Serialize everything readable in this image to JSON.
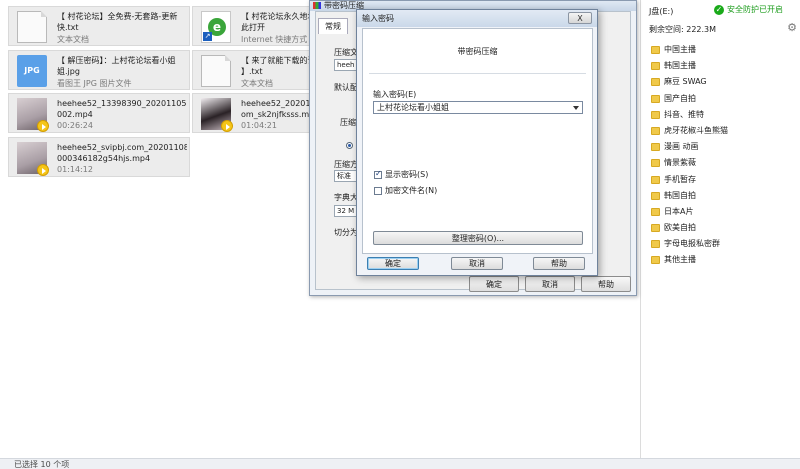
{
  "files": [
    {
      "name": "【 村花论坛】全免费-无套路-更新",
      "name2": "快.txt",
      "type": "文本文档",
      "icon": "text-file-icon"
    },
    {
      "name": "【 村花论坛永久地址",
      "name2": "此打开",
      "type": "Internet 快捷方式",
      "icon": "internet-shortcut-icon"
    },
    {
      "name": "【 解压密码】：上村花论坛看小姐",
      "name2": "姐.jpg",
      "type": "看图王 JPG 图片文件",
      "icon": "jpg-file-icon",
      "badge": "JPG"
    },
    {
      "name": "【 来了就能下载的论",
      "name2": "】.txt",
      "type": "文本文档",
      "icon": "text-file-icon"
    },
    {
      "name": "heehee52_13398390_202011050",
      "name2": "002.mp4",
      "duration": "00:26:24",
      "icon": "video-thumbnail-icon"
    },
    {
      "name": "heehee52_2020103",
      "name2": "om_sk2njfksss.mp4",
      "duration": "01:04:21",
      "icon": "video-thumbnail-icon"
    },
    {
      "name": "heehee52_svipbj.com_20201108",
      "name2": "000346182g54hjs.mp4",
      "duration": "01:14:12",
      "icon": "video-thumbnail-icon"
    }
  ],
  "status_bar": {
    "text": "已选择 10 个项"
  },
  "right_panel": {
    "drive": "J盘(E:)",
    "safe_label": "安全防护已开启",
    "free_space": "剩余空间: 222.3M",
    "folders": [
      "中国主播",
      "韩国主播",
      "麻豆 SWAG",
      "国产自拍",
      "抖音、推特",
      "虎牙花椒斗鱼熊猫",
      "漫画 动画",
      "情景紫薇",
      "手机暂存",
      "韩国自拍",
      "日本A片",
      "欧美自拍",
      "字母电报私密群",
      "其他主播"
    ]
  },
  "compression_dialog": {
    "title": "带密码压缩",
    "tab": "常规",
    "labels": [
      "压缩文",
      "heeh",
      "默认配",
      "压缩",
      "压缩方",
      "标准",
      "字典大",
      "32 M",
      "切分为"
    ],
    "buttons": {
      "ok": "确定",
      "cancel": "取消",
      "help": "帮助"
    }
  },
  "password_dialog": {
    "title": "输入密码",
    "close": "X",
    "heading": "带密码压缩",
    "password_label": "输入密码(E)",
    "password_value": "上村花论坛看小姐姐",
    "show_password": "显示密码(S)",
    "show_password_checked": true,
    "encrypt_names": "加密文件名(N)",
    "encrypt_names_checked": false,
    "organize_button": "整理密码(O)...",
    "ok": "确定",
    "cancel": "取消",
    "help": "帮助"
  }
}
